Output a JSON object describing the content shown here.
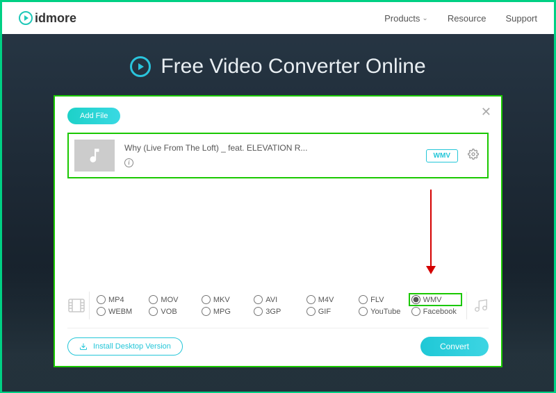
{
  "brand": "idmore",
  "nav": {
    "products": "Products",
    "resource": "Resource",
    "support": "Support"
  },
  "page_title": "Free Video Converter Online",
  "modal": {
    "add_file_label": "Add File",
    "file": {
      "name": "Why (Live From The Loft) _ feat. ELEVATION R...",
      "format_badge": "WMV"
    },
    "formats_row1": [
      "MP4",
      "MOV",
      "MKV",
      "AVI",
      "M4V",
      "FLV",
      "WMV"
    ],
    "formats_row2": [
      "WEBM",
      "VOB",
      "MPG",
      "3GP",
      "GIF",
      "YouTube",
      "Facebook"
    ],
    "selected_format": "WMV",
    "install_label": "Install Desktop Version",
    "convert_label": "Convert"
  }
}
